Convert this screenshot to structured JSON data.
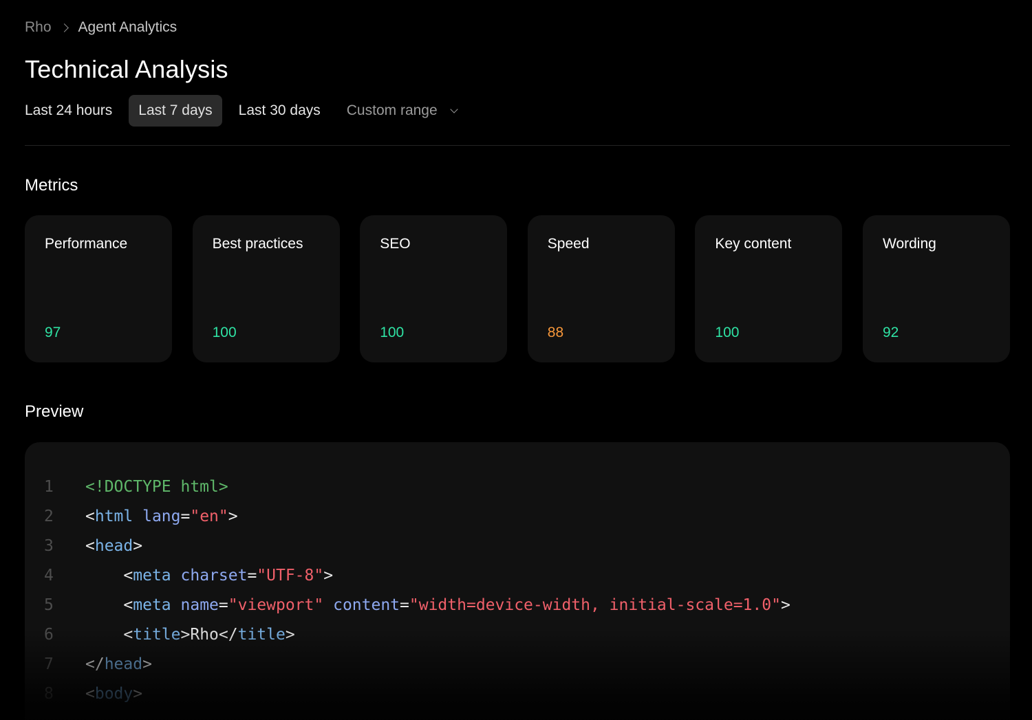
{
  "breadcrumb": {
    "root": "Rho",
    "current": "Agent Analytics"
  },
  "page": {
    "title": "Technical Analysis"
  },
  "range": {
    "tabs": [
      {
        "label": "Last 24 hours",
        "active": false
      },
      {
        "label": "Last 7 days",
        "active": true
      },
      {
        "label": "Last 30 days",
        "active": false
      },
      {
        "label": "Custom range",
        "active": false
      }
    ]
  },
  "metrics": {
    "title": "Metrics",
    "cards": [
      {
        "label": "Performance",
        "value": "97",
        "color": "#2fe3a4"
      },
      {
        "label": "Best practices",
        "value": "100",
        "color": "#2fe3a4"
      },
      {
        "label": "SEO",
        "value": "100",
        "color": "#2fe3a4"
      },
      {
        "label": "Speed",
        "value": "88",
        "color": "#f7973a"
      },
      {
        "label": "Key content",
        "value": "100",
        "color": "#2fe3a4"
      },
      {
        "label": "Wording",
        "value": "92",
        "color": "#2fe3a4"
      }
    ]
  },
  "preview": {
    "title": "Preview",
    "colors": {
      "doctype": "#5fb86a",
      "punct": "#e8e8e8",
      "tag": "#7bb4e8",
      "attr": "#8ea9f0",
      "string": "#f0606a",
      "text": "#e8e8e8",
      "linenum": "#4d4d4d"
    },
    "lines": [
      {
        "num": "1",
        "tokens": [
          {
            "t": "<!DOCTYPE html>",
            "k": "doctype"
          }
        ]
      },
      {
        "num": "2",
        "tokens": [
          {
            "t": "<",
            "k": "punct"
          },
          {
            "t": "html",
            "k": "tag"
          },
          {
            "t": " ",
            "k": "text"
          },
          {
            "t": "lang",
            "k": "attr"
          },
          {
            "t": "=",
            "k": "punct"
          },
          {
            "t": "\"en\"",
            "k": "string"
          },
          {
            "t": ">",
            "k": "punct"
          }
        ]
      },
      {
        "num": "3",
        "tokens": [
          {
            "t": "<",
            "k": "punct"
          },
          {
            "t": "head",
            "k": "tag"
          },
          {
            "t": ">",
            "k": "punct"
          }
        ]
      },
      {
        "num": "4",
        "tokens": [
          {
            "t": "    <",
            "k": "punct"
          },
          {
            "t": "meta",
            "k": "tag"
          },
          {
            "t": " ",
            "k": "text"
          },
          {
            "t": "charset",
            "k": "attr"
          },
          {
            "t": "=",
            "k": "punct"
          },
          {
            "t": "\"UTF-8\"",
            "k": "string"
          },
          {
            "t": ">",
            "k": "punct"
          }
        ]
      },
      {
        "num": "5",
        "tokens": [
          {
            "t": "    <",
            "k": "punct"
          },
          {
            "t": "meta",
            "k": "tag"
          },
          {
            "t": " ",
            "k": "text"
          },
          {
            "t": "name",
            "k": "attr"
          },
          {
            "t": "=",
            "k": "punct"
          },
          {
            "t": "\"viewport\"",
            "k": "string"
          },
          {
            "t": " ",
            "k": "text"
          },
          {
            "t": "content",
            "k": "attr"
          },
          {
            "t": "=",
            "k": "punct"
          },
          {
            "t": "\"width=device-width, initial-scale=1.0\"",
            "k": "string"
          },
          {
            "t": ">",
            "k": "punct"
          }
        ]
      },
      {
        "num": "6",
        "tokens": [
          {
            "t": "    <",
            "k": "punct"
          },
          {
            "t": "title",
            "k": "tag"
          },
          {
            "t": ">",
            "k": "punct"
          },
          {
            "t": "Rho",
            "k": "text"
          },
          {
            "t": "</",
            "k": "punct"
          },
          {
            "t": "title",
            "k": "tag"
          },
          {
            "t": ">",
            "k": "punct"
          }
        ]
      },
      {
        "num": "7",
        "tokens": [
          {
            "t": "</",
            "k": "punct"
          },
          {
            "t": "head",
            "k": "tag"
          },
          {
            "t": ">",
            "k": "punct"
          }
        ]
      },
      {
        "num": "8",
        "tokens": [
          {
            "t": "<",
            "k": "punct"
          },
          {
            "t": "body",
            "k": "tag"
          },
          {
            "t": ">",
            "k": "punct"
          }
        ]
      }
    ]
  }
}
